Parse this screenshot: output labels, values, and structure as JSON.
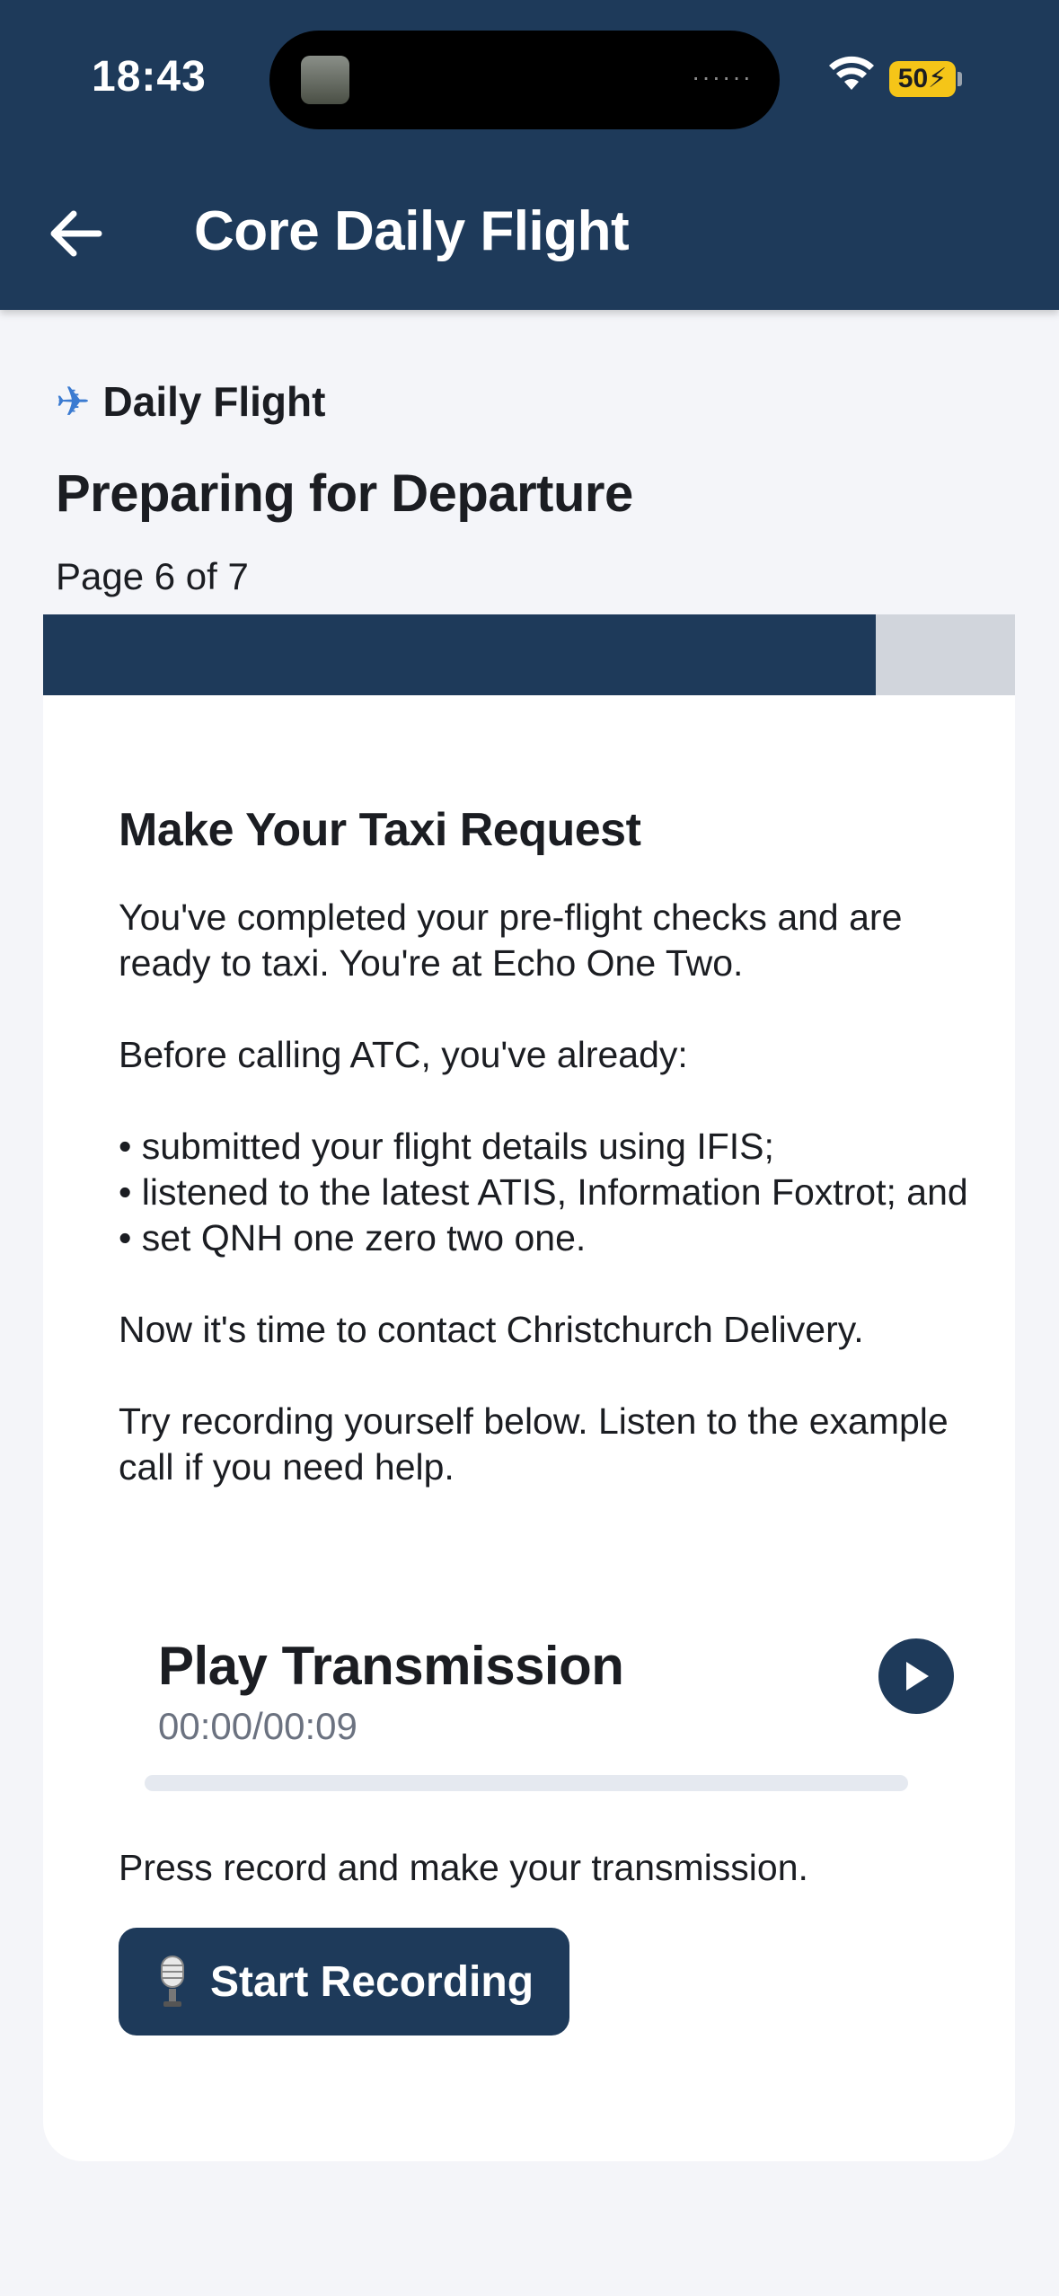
{
  "status_bar": {
    "time": "18:43",
    "battery": "50"
  },
  "header": {
    "title": "Core Daily Flight"
  },
  "lesson": {
    "tag": "Daily Flight",
    "title": "Preparing for Departure",
    "page_label": "Page 6 of 7",
    "progress": 0.857
  },
  "card": {
    "heading": "Make Your Taxi Request",
    "paragraphs": [
      "You've completed your pre-flight checks and are ready to taxi. You're at Echo One Two.",
      "Before calling ATC, you've already:",
      "• submitted your flight details using IFIS;",
      "• listened to the latest ATIS, Information Foxtrot; and",
      "• set QNH one zero two one.",
      "Now it's time to contact Christchurch Delivery.",
      "Try recording yourself below. Listen to the example call if you need help."
    ],
    "player": {
      "title": "Play Transmission",
      "time": "00:00/00:09",
      "progress": 0
    },
    "record_prompt": "Press record and make your transmission.",
    "record_button": "Start Recording"
  },
  "colors": {
    "navy": "#1e3a5a",
    "battery": "#f5c518"
  },
  "icons": [
    "back-arrow-icon",
    "airplane-icon",
    "play-icon",
    "microphone-icon",
    "wifi-icon"
  ]
}
